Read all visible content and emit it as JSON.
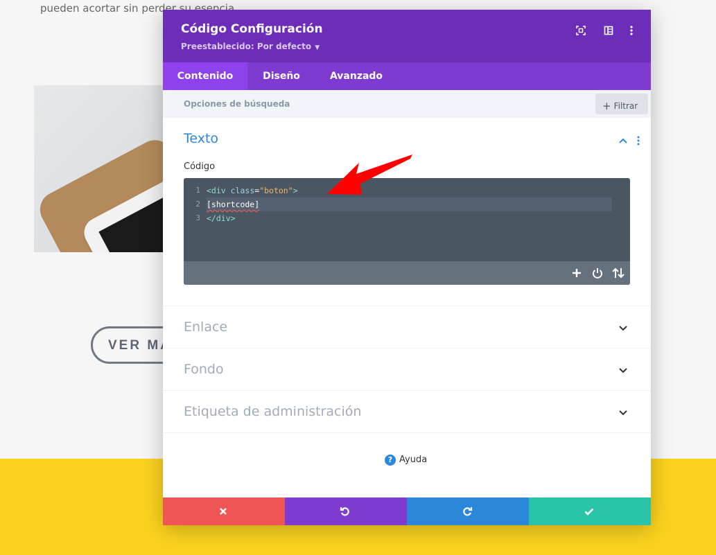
{
  "background": {
    "top_text": "pueden acortar sin perder su esencia",
    "button_label": "VER MA"
  },
  "modal": {
    "title": "Código Configuración",
    "preset_label": "Preestablecido: Por defecto",
    "header_icons": [
      "fullscreen-icon",
      "split-view-icon",
      "more-options-icon"
    ],
    "tabs": [
      {
        "label": "Contenido",
        "active": true
      },
      {
        "label": "Diseño",
        "active": false
      },
      {
        "label": "Avanzado",
        "active": false
      }
    ],
    "search_placeholder": "Opciones de búsqueda",
    "filter_label": "Filtrar",
    "sections": {
      "texto": "Texto",
      "code_label": "Código",
      "enlace": "Enlace",
      "fondo": "Fondo",
      "etiqueta": "Etiqueta de administración"
    },
    "editor": {
      "line_numbers": [
        "1",
        "2",
        "3"
      ],
      "line1": {
        "open": "<div ",
        "attr": "class",
        "eq": "=",
        "value": "\"boton\"",
        "close": ">"
      },
      "line2": {
        "text": "[shortcode]"
      },
      "line3": {
        "text": "</div>"
      }
    },
    "help_label": "Ayuda",
    "colors": {
      "header": "#6c2eb9",
      "cancel": "#ef5555",
      "undo": "#7e3bd0",
      "redo": "#2b87da",
      "save": "#29c4a9"
    }
  }
}
